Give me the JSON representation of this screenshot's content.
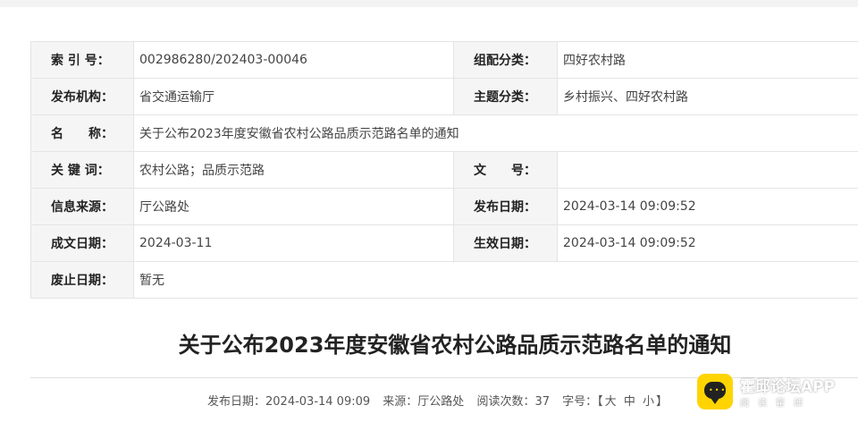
{
  "meta_table": {
    "index_label": "索 引 号：",
    "index_value": "002986280/202403-00046",
    "category_label": "组配分类：",
    "category_value": "四好农村路",
    "publisher_label": "发布机构：",
    "publisher_value": "省交通运输厅",
    "topic_label": "主题分类：",
    "topic_value": "乡村振兴、四好农村路",
    "name_label": "名　　称：",
    "name_value": "关于公布2023年度安徽省农村公路品质示范路名单的通知",
    "keywords_label": "关 键 词：",
    "keywords_value": "农村公路；品质示范路",
    "docno_label": "文　　号：",
    "docno_value": "",
    "source_label": "信息来源：",
    "source_value": "厅公路处",
    "publish_date_label": "发布日期：",
    "publish_date_value": "2024-03-14 09:09:52",
    "written_date_label": "成文日期：",
    "written_date_value": "2024-03-11",
    "effective_date_label": "生效日期：",
    "effective_date_value": "2024-03-14 09:09:52",
    "expiry_date_label": "废止日期：",
    "expiry_date_value": "暂无"
  },
  "article": {
    "title": "关于公布2023年度安徽省农村公路品质示范路名单的通知",
    "info": {
      "publish_date": "发布日期：2024-03-14 09:09",
      "source": "来源：厅公路处",
      "read_count": "阅读次数：37",
      "font_size_label": "字号：【",
      "size_large": "大",
      "size_medium": "中",
      "size_small": "小",
      "font_size_close": "】"
    }
  },
  "watermark": {
    "name": "霍邱论坛APP",
    "subtitle": "阅读霍邱",
    "icon": "chat-bubble-icon"
  },
  "colors": {
    "label_bg": "#f5f5f5",
    "border": "#e4e4e4",
    "brand_yellow": "#ffd400"
  }
}
